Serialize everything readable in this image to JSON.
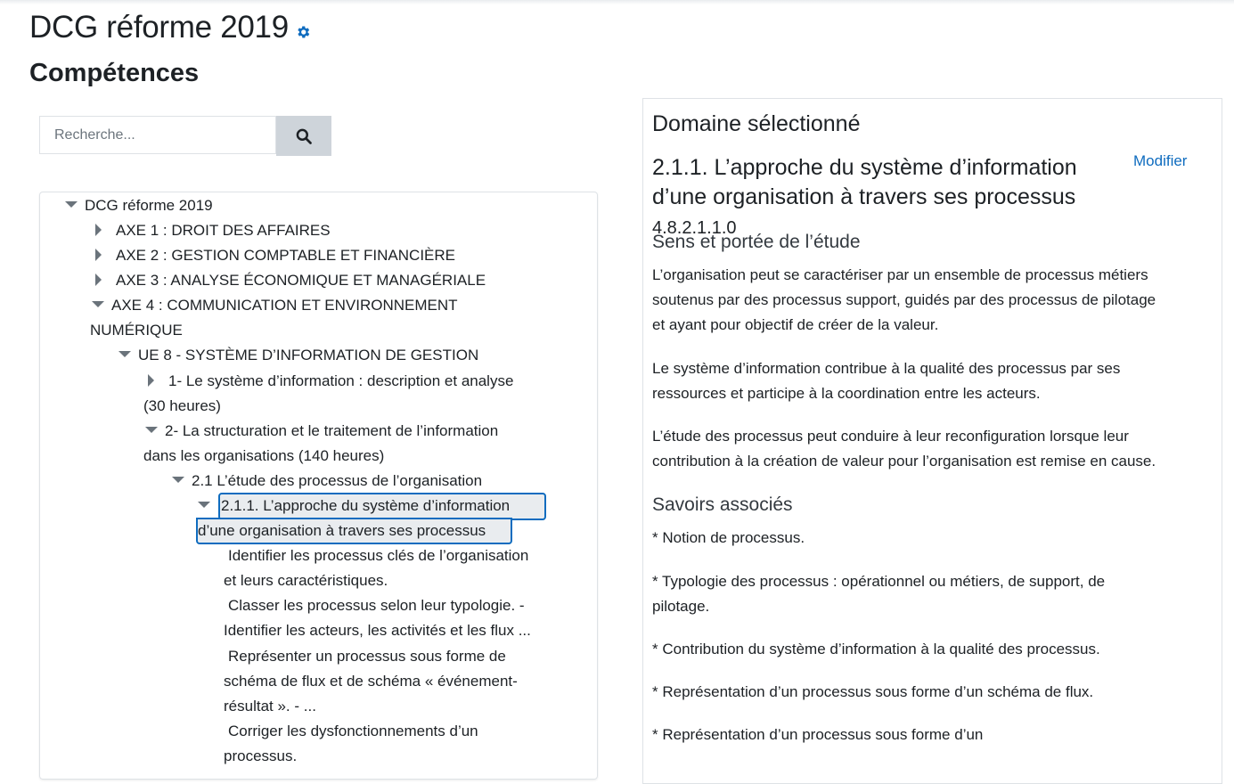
{
  "header": {
    "title": "DCG réforme 2019",
    "subtitle": "Compétences"
  },
  "search": {
    "placeholder": "Recherche..."
  },
  "tree": {
    "root": "DCG réforme 2019",
    "axe1": "AXE 1 : DROIT DES AFFAIRES",
    "axe2": "AXE 2 : GESTION COMPTABLE ET FINANCIÈRE",
    "axe3": "AXE 3 : ANALYSE ÉCONOMIQUE ET MANAGÉRIALE",
    "axe4_line1": "AXE 4 : COMMUNICATION ET ENVIRONNEMENT",
    "axe4_line2": "NUMÉRIQUE",
    "ue8": "UE 8 - SYSTÈME D’INFORMATION DE GESTION",
    "part1_line1": "1- Le système d’information : description et analyse",
    "part1_line2": "(30 heures)",
    "part2_line1": "2- La structuration et le traitement de l’information",
    "part2_line2": "dans les organisations (140 heures)",
    "sec21": "2.1 L’étude des processus de l’organisation",
    "sel_line1": "2.1.1. L’approche du système d’information",
    "sel_line2": "d’une organisation à travers ses processus",
    "comp1_line1": "Identifier les processus clés de l’organisation",
    "comp1_line2": "et leurs caractéristiques.",
    "comp2_line1": "Classer les processus selon leur typologie. -",
    "comp2_line2": "Identifier les acteurs, les activités et les flux ...",
    "comp3_line1": "Représenter un processus sous forme de",
    "comp3_line2": "schéma de flux et de schéma « événement-",
    "comp3_line3": "résultat ». - ...",
    "comp4_line1": "Corriger les dysfonctionnements d’un",
    "comp4_line2": "processus."
  },
  "panel": {
    "heading": "Domaine sélectionné",
    "domain_title_line1": "2.1.1. L’approche du système d’information",
    "domain_title_line2": "d’une organisation à travers ses processus",
    "domain_code": "4.8.2.1.1.0",
    "modify_label": "Modifier",
    "scope_title": "Sens et portée de l’étude",
    "scope_p1_l1": "L’organisation peut se caractériser par un ensemble de processus métiers",
    "scope_p1_l2": "soutenus par des processus support, guidés par des processus de pilotage",
    "scope_p1_l3": "et ayant pour objectif de créer de la valeur.",
    "scope_p2_l1": "Le système d’information contribue à la qualité des processus par ses",
    "scope_p2_l2": "ressources et participe à la coordination entre les acteurs.",
    "scope_p3_l1": "L’étude des processus peut conduire à leur reconfiguration lorsque leur",
    "scope_p3_l2": "contribution à la création de valeur pour l’organisation est remise en cause.",
    "knowledge_title": "Savoirs associés",
    "k1": "* Notion de processus.",
    "k2_l1": "* Typologie des processus : opérationnel ou métiers, de support, de",
    "k2_l2": "pilotage.",
    "k3": "* Contribution du système d’information à la qualité des processus.",
    "k4": "* Représentation d’un processus sous forme d’un schéma de flux.",
    "k5": "* Représentation d’un processus sous forme d’un"
  },
  "colors": {
    "accent": "#0f6cbf",
    "search_button": "#ced4da",
    "selected_bg": "#e9ecef"
  },
  "icons": {
    "settings": "gear-icon",
    "search": "search-icon"
  }
}
